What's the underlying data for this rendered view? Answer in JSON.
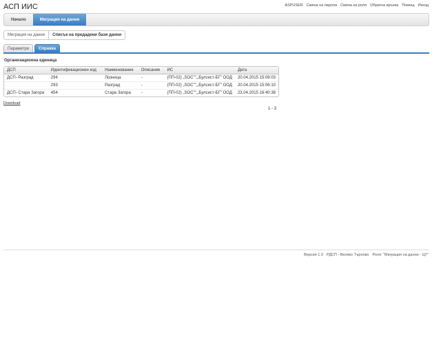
{
  "app": {
    "title": "АСП ИИС"
  },
  "top_links": [
    "ASPUSER",
    "Смяна на парола",
    "Смяна на роля",
    "Обратна връзка",
    "Помощ",
    "Изход"
  ],
  "nav": {
    "items": [
      "Начало",
      "Миграция на данни"
    ],
    "active_index": 1
  },
  "breadcrumb": {
    "parent": "Миграция на данни",
    "current": "Списък на предадени бази данни"
  },
  "tabs": {
    "items": [
      "Параметри",
      "Справка"
    ],
    "active_index": 1
  },
  "section": {
    "label": "Организационна единица"
  },
  "table": {
    "columns": [
      "ДСП",
      "Идентификационен код",
      "Наименование",
      "Описание",
      "ИС",
      "Дата"
    ],
    "rows": [
      [
        "ДСП- Разград",
        "294",
        "Лозница",
        "-",
        "(ПП-02) „SOC\"\",„Булсист-БГ\" ООД",
        "20.04.2015 15:08:03"
      ],
      [
        "",
        "293",
        "Разград",
        "-",
        "(ПП-02) „SOC\"\",„Булсист-БГ\" ООД",
        "20.04.2015 15:06:10"
      ],
      [
        "ДСП- Стара Загора",
        "454",
        "Стара Загора",
        "-",
        "(ПП-02) „SOC\"\",„Булсист-БГ\" ООД",
        "23.04.2015 16:40:38"
      ]
    ]
  },
  "download_label": "Download",
  "pager": {
    "text": "1 - 3"
  },
  "footer": {
    "version": "Версия 1.0",
    "org": "РДСП - Велико Търново",
    "role": "Роля: \"Миграция на данни - ЦУ\""
  },
  "colors": {
    "accent": "#3b7cbf"
  }
}
